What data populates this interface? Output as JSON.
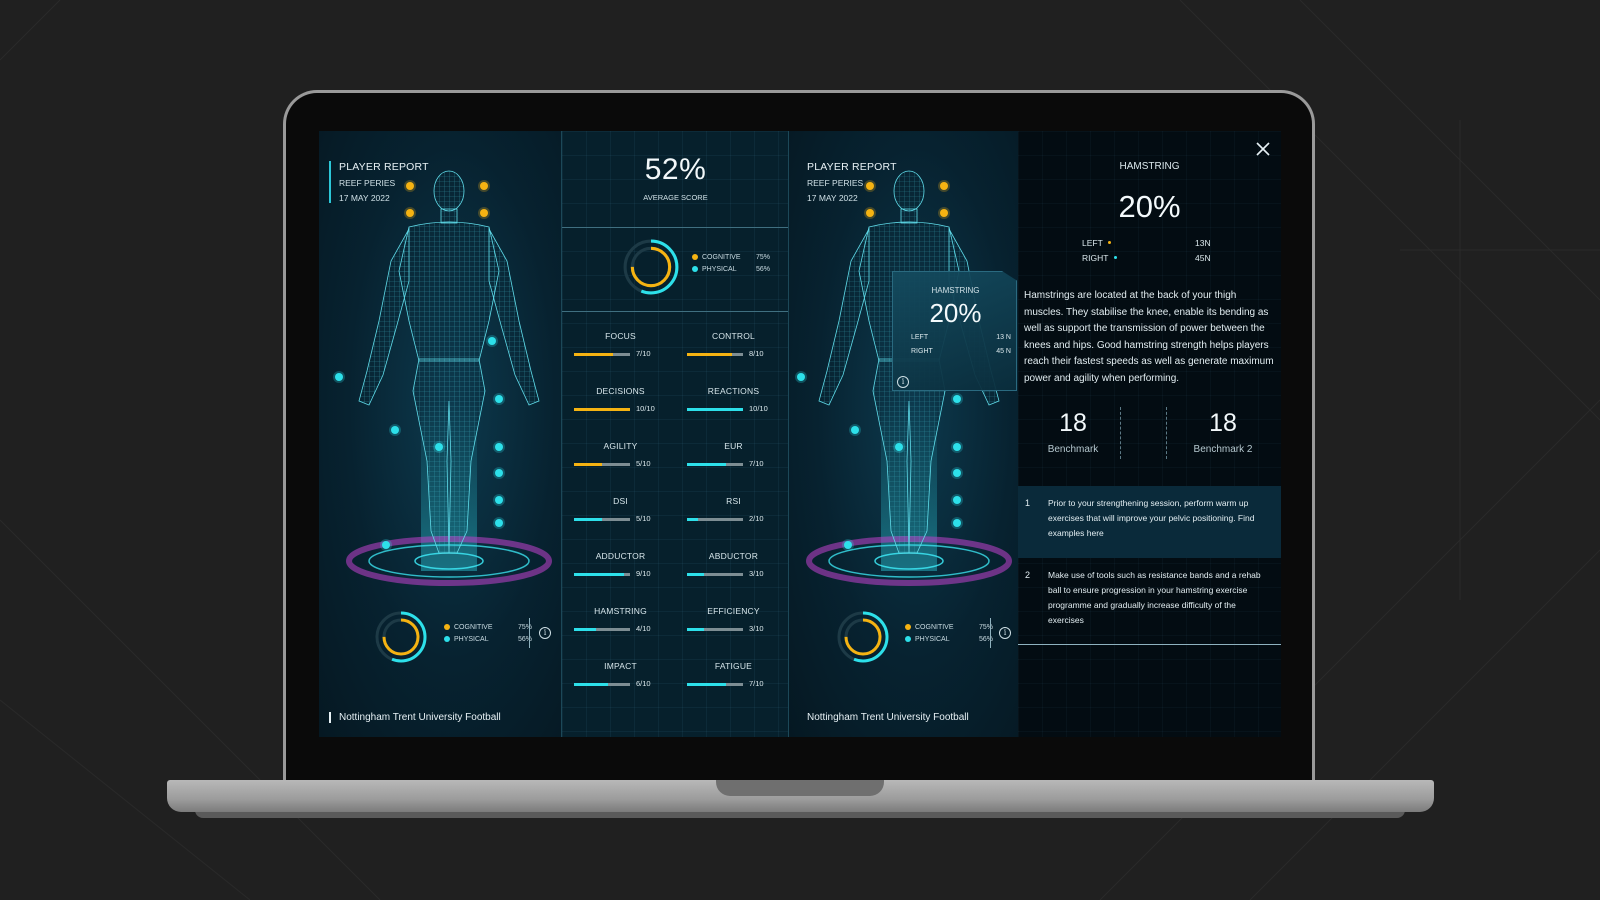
{
  "player": {
    "report_title": "PLAYER REPORT",
    "name": "REEF PERIES",
    "date": "17 MAY 2022",
    "club": "Nottingham Trent University Football"
  },
  "summary": {
    "average_score": "52%",
    "average_label": "AVERAGE SCORE",
    "cognitive_label": "COGNITIVE",
    "cognitive_pct": "75%",
    "physical_label": "PHYSICAL",
    "physical_pct": "56%",
    "cognitive_value": 0.75,
    "physical_value": 0.56
  },
  "metrics": [
    {
      "name": "FOCUS",
      "score": "7/10",
      "value": 7,
      "color": "#f5b312"
    },
    {
      "name": "CONTROL",
      "score": "8/10",
      "value": 8,
      "color": "#f5b312"
    },
    {
      "name": "DECISIONS",
      "score": "10/10",
      "value": 10,
      "color": "#f5b312"
    },
    {
      "name": "REACTIONS",
      "score": "10/10",
      "value": 10,
      "color": "#2de0ea"
    },
    {
      "name": "AGILITY",
      "score": "5/10",
      "value": 5,
      "color": "#f5b312"
    },
    {
      "name": "EUR",
      "score": "7/10",
      "value": 7,
      "color": "#2de0ea"
    },
    {
      "name": "DSI",
      "score": "5/10",
      "value": 5,
      "color": "#2de0ea"
    },
    {
      "name": "RSI",
      "score": "2/10",
      "value": 2,
      "color": "#2de0ea"
    },
    {
      "name": "ADDUCTOR",
      "score": "9/10",
      "value": 9,
      "color": "#2de0ea"
    },
    {
      "name": "ABDUCTOR",
      "score": "3/10",
      "value": 3,
      "color": "#2de0ea"
    },
    {
      "name": "HAMSTRING",
      "score": "4/10",
      "value": 4,
      "color": "#2de0ea"
    },
    {
      "name": "EFFICIENCY",
      "score": "3/10",
      "value": 3,
      "color": "#2de0ea"
    },
    {
      "name": "IMPACT",
      "score": "6/10",
      "value": 6,
      "color": "#2de0ea"
    },
    {
      "name": "FATIGUE",
      "score": "7/10",
      "value": 7,
      "color": "#2de0ea"
    }
  ],
  "popup": {
    "title": "HAMSTRING",
    "value": "20%",
    "left_label": "LEFT",
    "left_value": "13 N",
    "right_label": "RIGHT",
    "right_value": "45 N"
  },
  "detail": {
    "title": "HAMSTRING",
    "value": "20%",
    "left_label": "LEFT",
    "left_value": "13N",
    "right_label": "RIGHT",
    "right_value": "45N",
    "description": "Hamstrings are located at the back of your thigh muscles. They stabilise the knee, enable its bending as well as support the transmission of power between the knees and hips. Good hamstring strength helps players reach their fastest speeds as well as generate maximum power and agility when performing.",
    "benchmark1_value": "18",
    "benchmark1_label": "Benchmark",
    "benchmark2_value": "18",
    "benchmark2_label": "Benchmark 2",
    "tips": [
      {
        "num": "1",
        "text": "Prior to your strengthening session, perform warm up exercises that will improve your pelvic positioning. Find examples here"
      },
      {
        "num": "2",
        "text": "Make use of tools such as resistance bands and a rehab ball to ensure progression in your hamstring exercise programme and gradually increase difficulty of the exercises"
      }
    ]
  },
  "colors": {
    "cognitive": "#f5b312",
    "physical": "#2de0ea",
    "accent": "#2cc7d8"
  },
  "icons": {
    "close": "close-icon",
    "info": "info-icon"
  }
}
